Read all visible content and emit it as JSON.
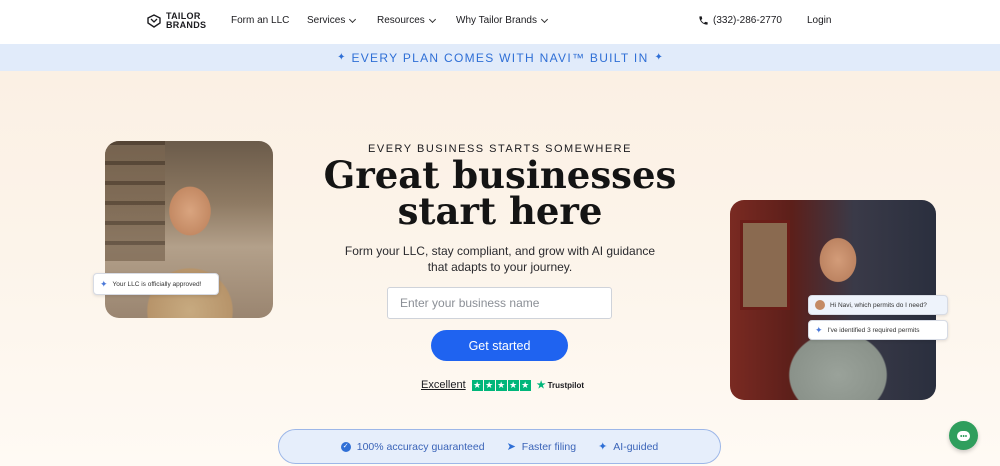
{
  "nav": {
    "logo_line1": "TAILOR",
    "logo_line2": "BRANDS",
    "items": [
      {
        "label": "Form an LLC",
        "has_dropdown": false
      },
      {
        "label": "Services",
        "has_dropdown": true
      },
      {
        "label": "Resources",
        "has_dropdown": true
      },
      {
        "label": "Why Tailor Brands",
        "has_dropdown": true
      }
    ],
    "phone": "(332)-286-2770",
    "login": "Login"
  },
  "banner": {
    "text": "EVERY PLAN COMES WITH NAVI™ BUILT IN",
    "icon": "sparkle-icon",
    "color": "#2f6fd6"
  },
  "hero": {
    "eyebrow": "EVERY BUSINESS STARTS SOMEWHERE",
    "headline_line1": "Great businesses",
    "headline_line2": "start here",
    "sub_line1": "Form your LLC, stay compliant, and grow with AI guidance",
    "sub_line2": "that adapts to your journey.",
    "input_placeholder": "Enter your business name",
    "input_value": "",
    "cta": "Get started",
    "cta_color": "#1f63f0"
  },
  "chips": {
    "left": "Your LLC is officially approved!",
    "navi_question": "Hi Navi, which permits do I need?",
    "navi_answer": "I've identified 3 required permits"
  },
  "trustpilot": {
    "rating_word": "Excellent",
    "brand": "Trustpilot",
    "stars": 5,
    "star_color": "#00b67a"
  },
  "features": [
    {
      "label": "100% accuracy guaranteed",
      "icon": "check-badge-icon"
    },
    {
      "label": "Faster filing",
      "icon": "fast-arrows-icon"
    },
    {
      "label": "AI-guided",
      "icon": "sparkle-icon"
    }
  ],
  "chat": {
    "icon": "chat-bubble-icon",
    "color": "#2f9e5d"
  }
}
